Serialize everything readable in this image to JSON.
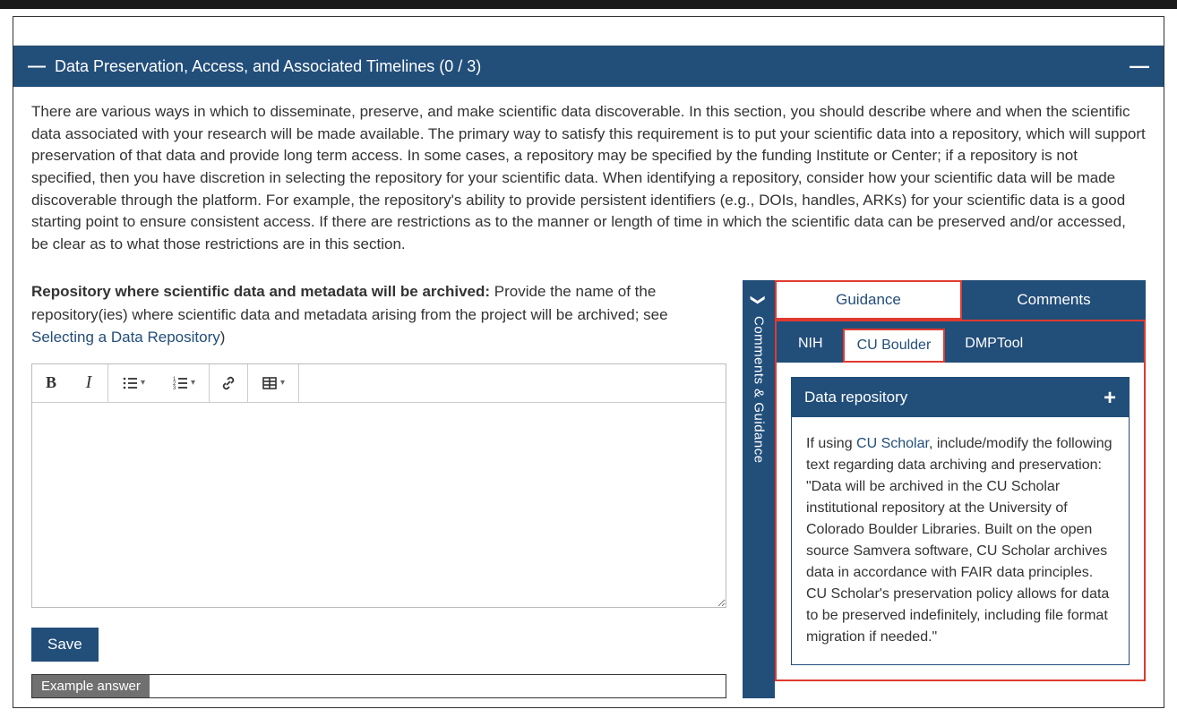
{
  "section": {
    "title": "Data Preservation, Access, and Associated Timelines (0 / 3)",
    "intro": "There are various ways in which to disseminate, preserve, and make scientific data discoverable. In this section, you should describe where and when the scientific data associated with your research will be made available. The primary way to satisfy this requirement is to put your scientific data into a repository, which will support preservation of that data and provide long term access. In some cases, a repository may be specified by the funding Institute or Center; if a repository is not specified, then you have discretion in selecting the repository for your scientific data. When identifying a repository, consider how your scientific data will be made discoverable through the platform. For example, the repository's ability to provide persistent identifiers (e.g., DOIs, handles, ARKs) for your scientific data is a good starting point to ensure consistent access. If there are restrictions as to the manner or length of time in which the scientific data can be preserved and/or accessed, be clear as to what those restrictions are in this section."
  },
  "question": {
    "bold": "Repository where scientific data and metadata will be archived:",
    "rest": " Provide the name of the repository(ies) where scientific data and metadata arising from the project will be archived; see  ",
    "link": "Selecting a Data Repository",
    "end": ")"
  },
  "editor": {
    "value": "",
    "placeholder": ""
  },
  "buttons": {
    "save": "Save"
  },
  "example": {
    "header": "Example answer"
  },
  "sidebar": {
    "rail_label": "Comments & Guidance",
    "tabs": {
      "guidance": "Guidance",
      "comments": "Comments"
    },
    "subtabs": {
      "nih": "NIH",
      "cuboulder": "CU Boulder",
      "dmptool": "DMPTool"
    },
    "card": {
      "title": "Data repository",
      "body_prefix": "If using ",
      "body_link": "CU Scholar",
      "body_rest": ", include/modify the following text regarding data archiving and preservation: \"Data will be archived in the CU Scholar institutional repository at the University of Colorado Boulder Libraries. Built on the open source Samvera software, CU Scholar archives data in accordance with FAIR data principles. CU Scholar's preservation policy allows for data to be preserved indefinitely, including file format migration if needed.\""
    }
  }
}
